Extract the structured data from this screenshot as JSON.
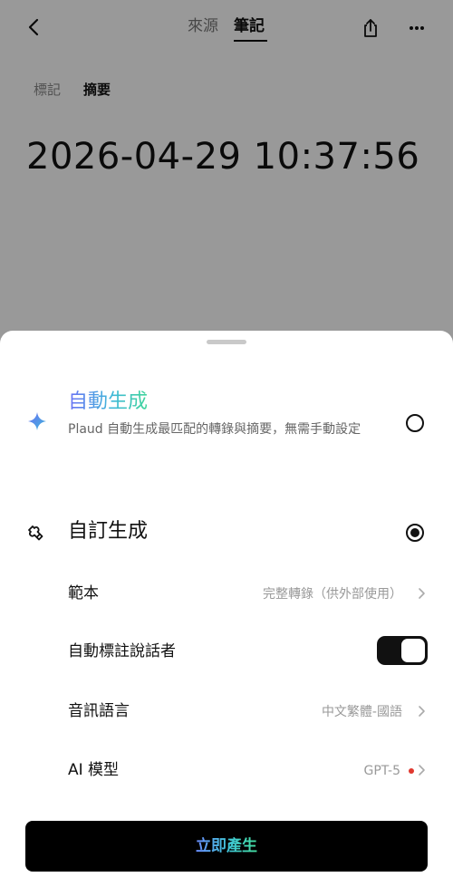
{
  "header": {
    "tabs": [
      {
        "label": "來源",
        "active": false
      },
      {
        "label": "筆記",
        "active": true
      }
    ],
    "icons": [
      "back-icon",
      "share-icon",
      "more-icon"
    ]
  },
  "subtabs": [
    {
      "label": "標記",
      "active": false
    },
    {
      "label": "摘要",
      "active": true
    }
  ],
  "note_timestamp": "2026-04-29 10:37:56",
  "sheet": {
    "auto": {
      "title": "自動生成",
      "description": "Plaud 自動生成最匹配的轉錄與摘要，無需手動設定",
      "selected": false,
      "icon": "sparkle-icon"
    },
    "custom": {
      "title": "自訂生成",
      "selected": true,
      "icon": "puzzle-icon"
    },
    "options": {
      "template": {
        "label": "範本",
        "value": "完整轉錄（供外部使用）"
      },
      "speaker_labeling": {
        "label": "自動標註說話者",
        "enabled": true
      },
      "audio_language": {
        "label": "音訊語言",
        "value": "中文繁體-國語"
      },
      "ai_model": {
        "label": "AI 模型",
        "value": "GPT-5",
        "badge_color": "#e0382e"
      }
    },
    "generate_button": "立即產生"
  },
  "colors": {
    "dim_overlay": "#666666",
    "gradient_start": "#6a6ff5",
    "gradient_end": "#3fd59a",
    "button_bg": "#000000"
  }
}
